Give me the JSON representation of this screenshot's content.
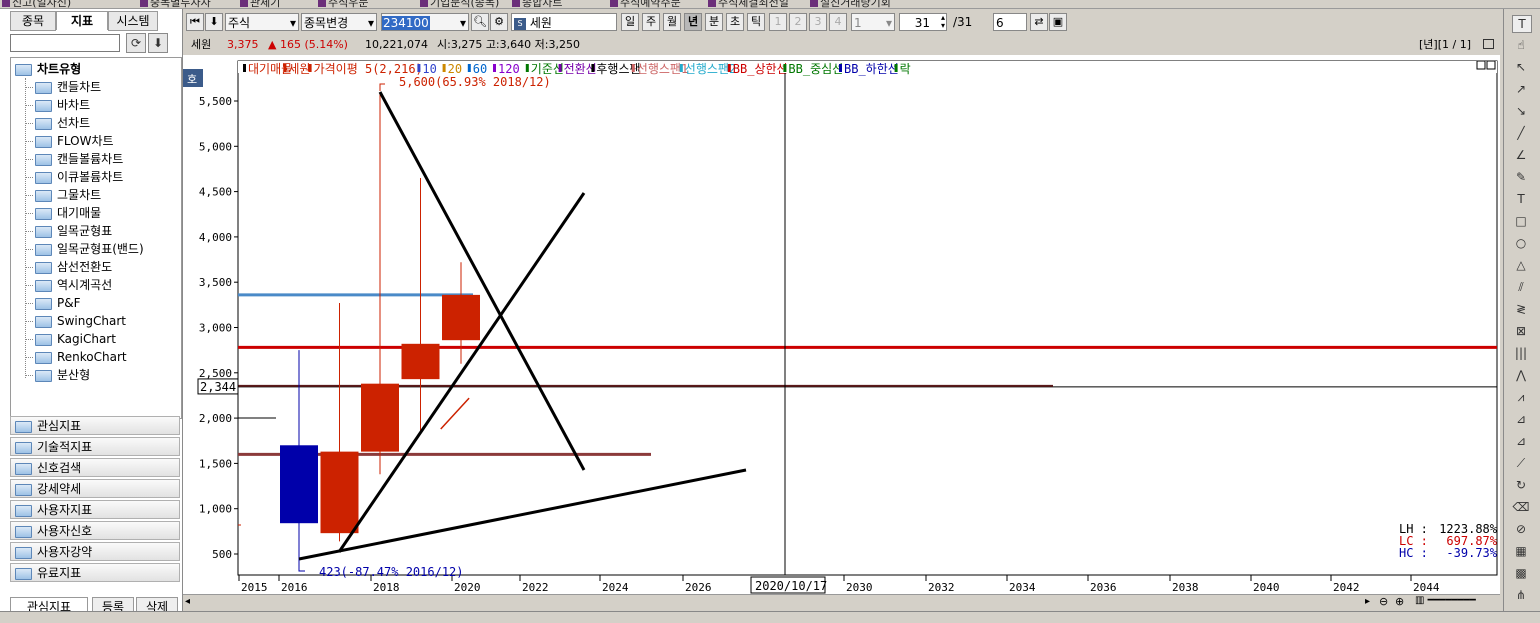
{
  "top_tabs": [
    "신고(일자신)",
    "중목별투자자",
    "관체기",
    "주식우문",
    "기업분석(종목)",
    "종합차트",
    "주식예약주문",
    "주식체결최전일",
    "실진거래량기회"
  ],
  "left_panel": {
    "tabs": [
      "종목",
      "지표",
      "시스템"
    ],
    "active_tab": "지표",
    "tree_root": "차트유형",
    "tree_items": [
      "캔들차트",
      "바차트",
      "선차트",
      "FLOW차트",
      "캔들볼륨차트",
      "이큐볼륨차트",
      "그물차트",
      "대기매물",
      "일목균형표",
      "일목균형표(밴드)",
      "삼선전환도",
      "역시계곡선",
      "P&F",
      "SwingChart",
      "KagiChart",
      "RenkoChart",
      "분산형"
    ],
    "categories": [
      "관심지표",
      "기술적지표",
      "신호검색",
      "강세약세",
      "사용자지표",
      "사용자신호",
      "사용자강약",
      "유료지표"
    ],
    "bottom_tabs": [
      "관심지표",
      "등록",
      "삭제"
    ]
  },
  "toolbar": {
    "market_select": "주식",
    "change_btn": "종목변경",
    "code_value": "234100",
    "stock_name": "세원",
    "periods": [
      "일",
      "주",
      "월",
      "년",
      "분",
      "초",
      "틱"
    ],
    "active_period": "년",
    "nums": [
      "1",
      "2",
      "3",
      "4"
    ],
    "num_select": "1",
    "count_value": "31",
    "count_total": "/31",
    "extra_value": "6"
  },
  "infobar": {
    "name": "세원",
    "price": "3,375",
    "change": "▲ 165 (5.14%)",
    "volume": "10,221,074",
    "ohlc": "시:3,275 고:3,640 저:3,250",
    "page": "[년][1 / 1]"
  },
  "colors": {
    "up": "#cc2200",
    "down": "#0000aa",
    "hline_red": "#cc0000",
    "hline_blue": "#4a8ac8",
    "hline_brown": "#8b3a3a",
    "hline_dark": "#5a1a1a"
  },
  "chart": {
    "badge": "호",
    "legend": [
      {
        "t": "대기매물",
        "c": "#cc2200",
        "m": "#000"
      },
      {
        "t": "세원",
        "c": "#cc2200",
        "m": "#cc2200"
      },
      {
        "t": "가격이평 5(2,216)",
        "c": "#cc2200",
        "m": "#cc2200"
      },
      {
        "t": "10",
        "c": "#3344cc",
        "m": "#3344cc"
      },
      {
        "t": "20",
        "c": "#cc8800",
        "m": "#cc8800"
      },
      {
        "t": "60",
        "c": "#0066cc",
        "m": "#0066cc"
      },
      {
        "t": "120",
        "c": "#8800cc",
        "m": "#8800cc"
      },
      {
        "t": "기준선",
        "c": "#007700",
        "m": "#007700"
      },
      {
        "t": "전환선",
        "c": "#7700aa",
        "m": "#7700aa"
      },
      {
        "t": "후행스팬",
        "c": "#000000",
        "m": "#000000"
      },
      {
        "t": "선행스팬1",
        "c": "#cc6666",
        "m": "#cc6666"
      },
      {
        "t": "선행스팬2",
        "c": "#22aacc",
        "m": "#22aacc"
      },
      {
        "t": "BB_상한선",
        "c": "#cc0000",
        "m": "#cc0000"
      },
      {
        "t": "BB_중심선",
        "c": "#007700",
        "m": "#007700"
      },
      {
        "t": "BB_하한선",
        "c": "#0000aa",
        "m": "#0000aa"
      },
      {
        "t": "락",
        "c": "#007700",
        "m": "#007700"
      }
    ],
    "current_price_label": "2,344",
    "high_annotation": "5,600(65.93% 2018/12)",
    "low_annotation": "423(-87.47% 2016/12)",
    "crosshair_date": "2020/10/17",
    "stats": [
      {
        "label": "LH :",
        "value": "1223.88%",
        "color": "#000"
      },
      {
        "label": "LC :",
        "value": "697.87%",
        "color": "#cc0000"
      },
      {
        "label": "HC :",
        "value": "-39.73%",
        "color": "#0000aa"
      }
    ]
  },
  "chart_data": {
    "type": "candlestick",
    "yticks": [
      500,
      1000,
      1500,
      2000,
      2500,
      3000,
      3500,
      4000,
      4500,
      5000,
      5500
    ],
    "ytick_labels": [
      "500",
      "1,000",
      "1,500",
      "2,000",
      "2,500",
      "3,000",
      "3,500",
      "4,000",
      "4,500",
      "5,000",
      "5,500"
    ],
    "xtick_labels": [
      "2015",
      "2016",
      "2018",
      "2020",
      "2022",
      "2024",
      "2026",
      "2030",
      "2032",
      "2034",
      "2036",
      "2038",
      "2040",
      "2042",
      "2044"
    ],
    "candles": [
      {
        "x": 2016,
        "o": 1700,
        "h": 2750,
        "l": 430,
        "c": 840
      },
      {
        "x": 2017,
        "o": 730,
        "h": 3270,
        "l": 640,
        "c": 1630
      },
      {
        "x": 2018,
        "o": 1630,
        "h": 5600,
        "l": 1380,
        "c": 2380
      },
      {
        "x": 2019,
        "o": 2430,
        "h": 4650,
        "l": 1850,
        "c": 2820
      },
      {
        "x": 2020,
        "o": 2860,
        "h": 3720,
        "l": 2600,
        "c": 3360
      }
    ],
    "hlines": [
      3360,
      2780,
      2344,
      1600
    ],
    "line_bb_tail": [
      [
        2019.5,
        1880
      ],
      [
        2020.2,
        2220
      ]
    ]
  }
}
